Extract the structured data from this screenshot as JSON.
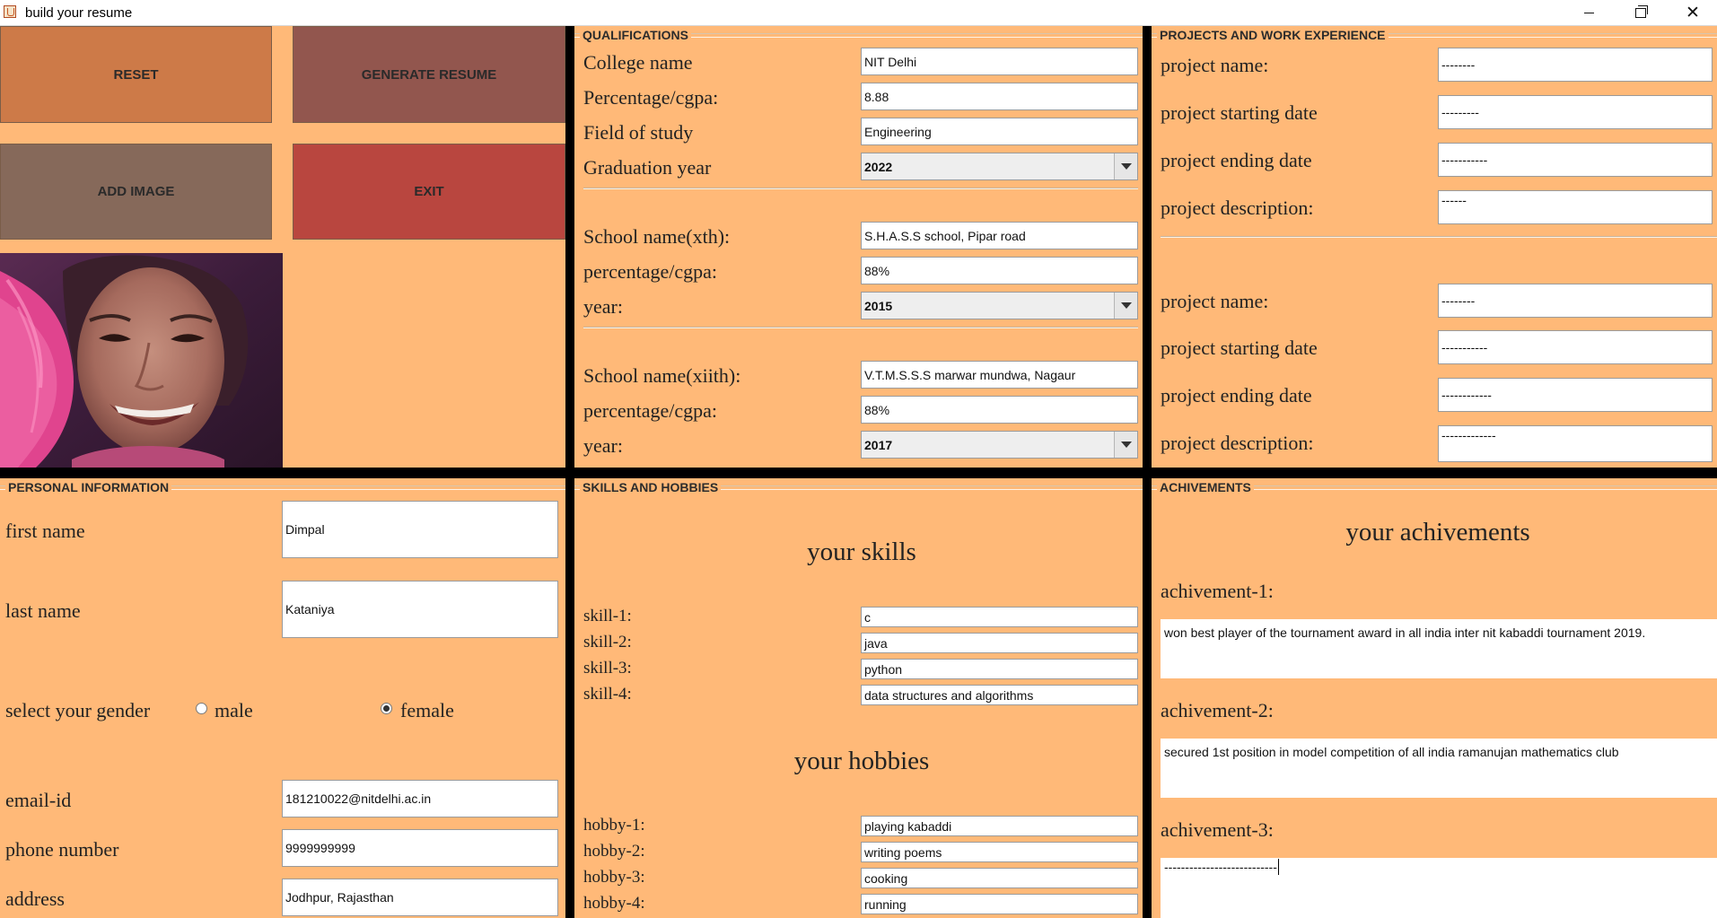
{
  "window": {
    "title": "build your resume"
  },
  "actions": {
    "reset": "RESET",
    "generate": "GENERATE RESUME",
    "add_image": "ADD IMAGE",
    "exit": "EXIT"
  },
  "qualifications": {
    "header": "QUALIFICATIONS",
    "college_label": "College name",
    "college": "NIT Delhi",
    "grad_pct_label": "Percentage/cgpa:",
    "grad_pct": "8.88",
    "field_label": "Field of study",
    "field": "Engineering",
    "grad_year_label": "Graduation year",
    "grad_year": "2022",
    "school10_label": "School name(xth):",
    "school10": "S.H.A.S.S school, Pipar road",
    "pct10_label": "percentage/cgpa:",
    "pct10": "88%",
    "year10_label": "year:",
    "year10": "2015",
    "school12_label": "School name(xiith):",
    "school12": "V.T.M.S.S.S marwar mundwa, Nagaur",
    "pct12_label": "percentage/cgpa:",
    "pct12": "88%",
    "year12_label": "year:",
    "year12": "2017"
  },
  "projects": {
    "header": "PROJECTS AND WORK EXPERIENCE",
    "p1": {
      "name_label": "project name:",
      "name": "--------",
      "start_label": "project starting date",
      "start": "---------",
      "end_label": "project ending date",
      "end": "-----------",
      "desc_label": "project description:",
      "desc": "------"
    },
    "p2": {
      "name_label": "project name:",
      "name": "--------",
      "start_label": "project starting date",
      "start": "-----------",
      "end_label": "project ending date",
      "end": "------------",
      "desc_label": "project description:",
      "desc": "-------------"
    }
  },
  "personal": {
    "header": "PERSONAL INFORMATION",
    "first_name_label": "first name",
    "first_name": "Dimpal",
    "last_name_label": "last name",
    "last_name": "Kataniya",
    "gender_label": "select your gender",
    "male_label": "male",
    "female_label": "female",
    "gender_selected": "female",
    "email_label": "email-id",
    "email": "181210022@nitdelhi.ac.in",
    "phone_label": "phone number",
    "phone": "9999999999",
    "address_label": "address",
    "address": "Jodhpur, Rajasthan"
  },
  "skills": {
    "header": "SKILLS AND HOBBIES",
    "skills_title": "your skills",
    "skill_list": [
      {
        "label": "skill-1:",
        "value": "c"
      },
      {
        "label": "skill-2:",
        "value": "java"
      },
      {
        "label": "skill-3:",
        "value": "python"
      },
      {
        "label": "skill-4:",
        "value": "data structures and algorithms"
      }
    ],
    "hobbies_title": "your hobbies",
    "hobby_list": [
      {
        "label": "hobby-1:",
        "value": "playing kabaddi"
      },
      {
        "label": "hobby-2:",
        "value": "writing poems"
      },
      {
        "label": "hobby-3:",
        "value": "cooking"
      },
      {
        "label": "hobby-4:",
        "value": "running"
      }
    ]
  },
  "achievements": {
    "header": "ACHIVEMENTS",
    "title": "your achivements",
    "a1_label": "achivement-1:",
    "a1": "won best player of the tournament award in all india inter nit kabaddi tournament 2019.",
    "a2_label": "achivement-2:",
    "a2": "secured 1st position in model competition of all india ramanujan mathematics club",
    "a3_label": "achivement-3:",
    "a3": "---------------------------"
  }
}
